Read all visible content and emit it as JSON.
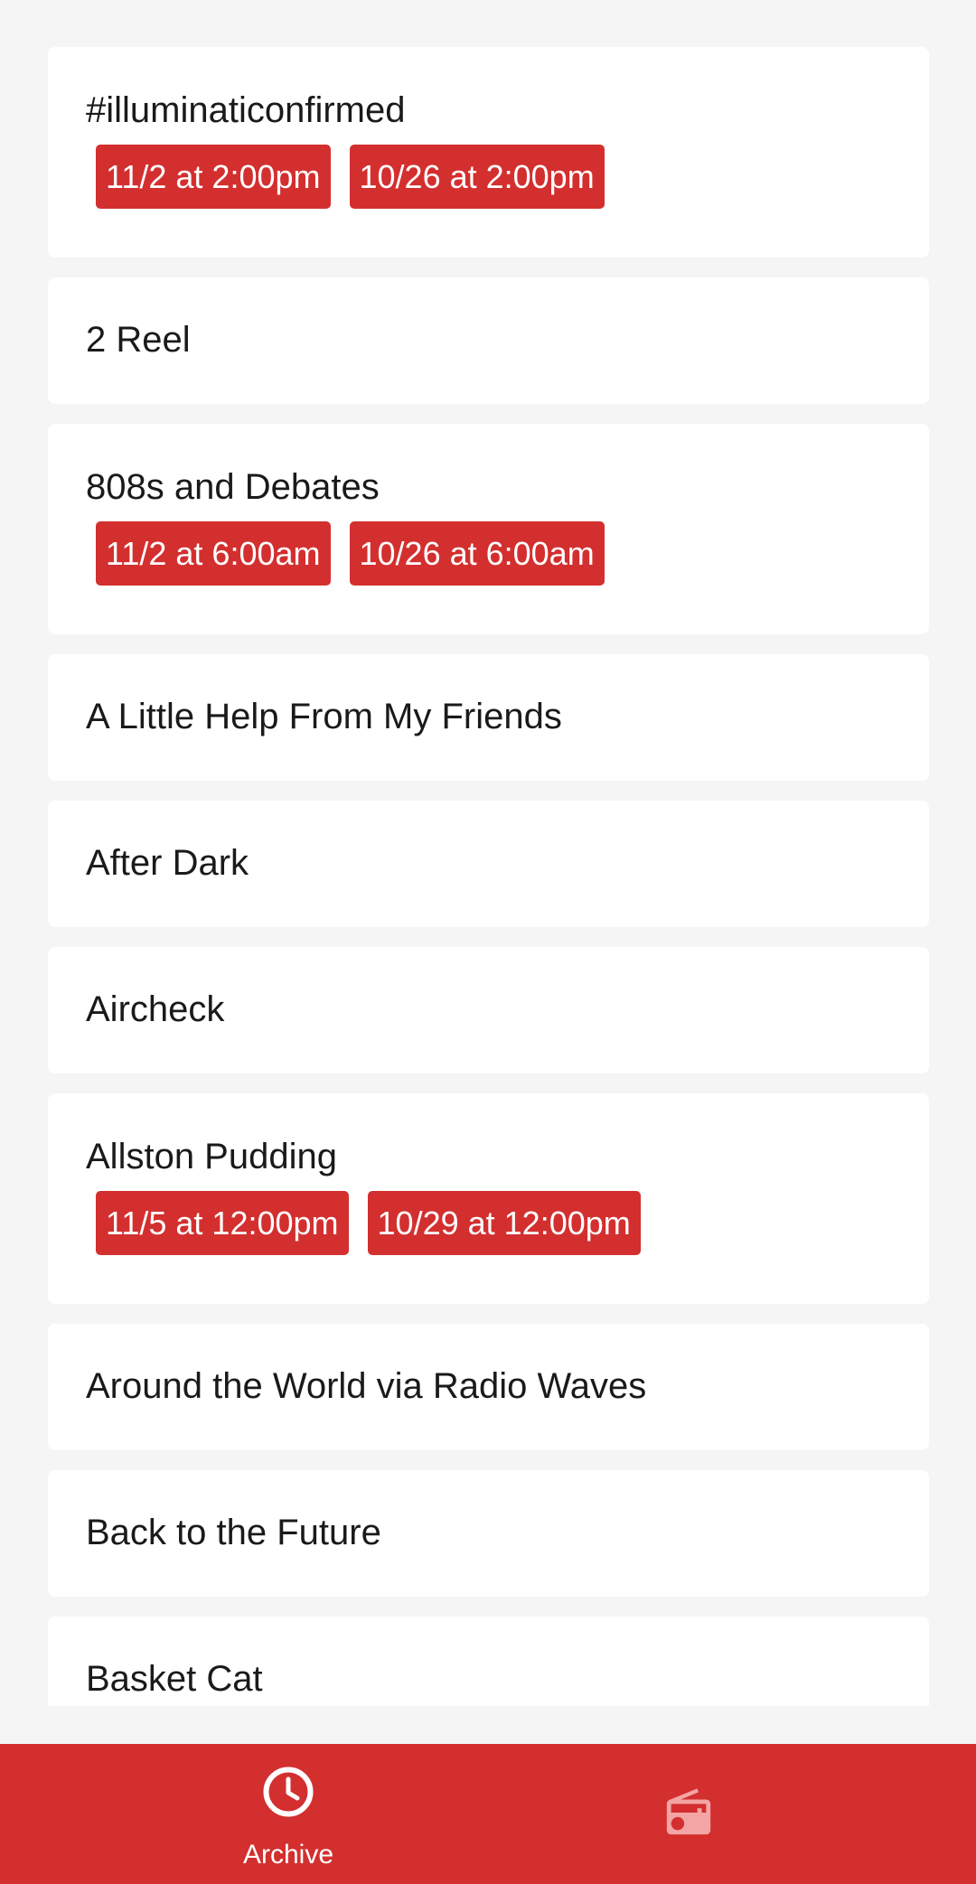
{
  "shows": [
    {
      "title": "#illuminaticonfirmed",
      "times": [
        "11/2 at 2:00pm",
        "10/26 at 2:00pm"
      ]
    },
    {
      "title": "2 Reel",
      "times": []
    },
    {
      "title": "808s and Debates",
      "times": [
        "11/2 at 6:00am",
        "10/26 at 6:00am"
      ]
    },
    {
      "title": "A Little Help From My Friends",
      "times": []
    },
    {
      "title": "After Dark",
      "times": []
    },
    {
      "title": "Aircheck",
      "times": []
    },
    {
      "title": "Allston Pudding",
      "times": [
        "11/5 at 12:00pm",
        "10/29 at 12:00pm"
      ]
    },
    {
      "title": "Around the World via Radio Waves",
      "times": []
    },
    {
      "title": "Back to the Future",
      "times": []
    },
    {
      "title": "Basket Cat",
      "times": []
    }
  ],
  "bottom_nav": {
    "archive_label": "Archive",
    "archive_icon": "clock-icon",
    "radio_icon": "radio-icon",
    "active_item": "archive"
  },
  "colors": {
    "accent": "#d32f2f",
    "background": "#f5f5f5",
    "card": "#ffffff",
    "inactive_icon": "#f3a5a5"
  }
}
